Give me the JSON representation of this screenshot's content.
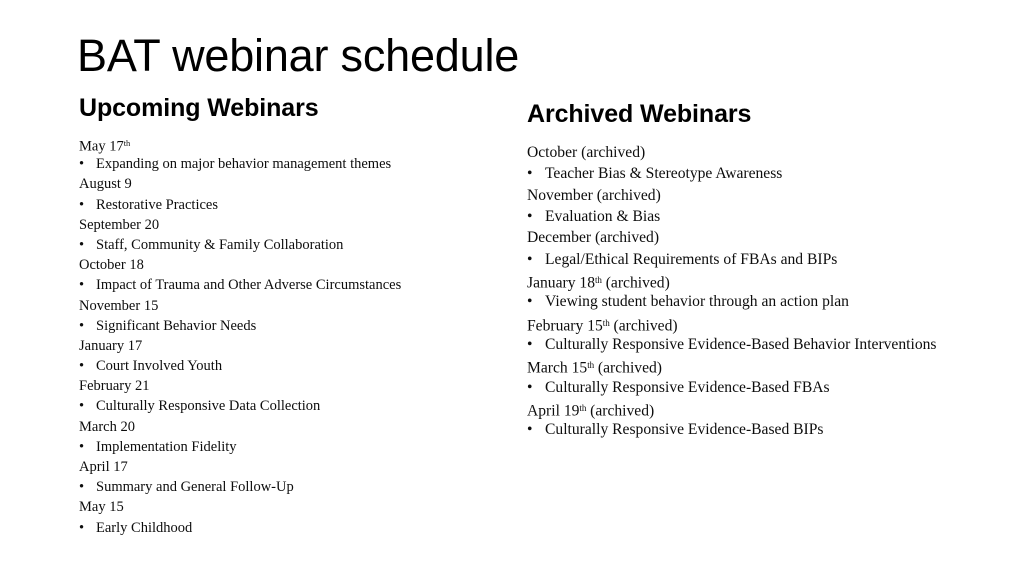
{
  "slide": {
    "title": "BAT webinar schedule",
    "background_color": "#ffffff",
    "text_color": "#000000"
  },
  "columns": {
    "upcoming": {
      "heading": "Upcoming Webinars",
      "bullet_glyph": "•",
      "entries": [
        {
          "date": "May 17",
          "ordinal": "th",
          "topic": "Expanding on major behavior management themes"
        },
        {
          "date": "August 9",
          "ordinal": "",
          "topic": "Restorative Practices"
        },
        {
          "date": "September 20",
          "ordinal": "",
          "topic": "Staff, Community & Family Collaboration"
        },
        {
          "date": "October 18",
          "ordinal": "",
          "topic": "Impact of Trauma and Other Adverse Circumstances"
        },
        {
          "date": "November 15",
          "ordinal": "",
          "topic": "Significant Behavior Needs"
        },
        {
          "date": "January 17",
          "ordinal": "",
          "topic": "Court Involved Youth"
        },
        {
          "date": "February 21",
          "ordinal": "",
          "topic": "Culturally Responsive Data Collection"
        },
        {
          "date": "March 20",
          "ordinal": "",
          "topic": "Implementation Fidelity"
        },
        {
          "date": "April 17",
          "ordinal": "",
          "topic": "Summary and General Follow-Up"
        },
        {
          "date": "May 15",
          "ordinal": "",
          "topic": "Early Childhood"
        }
      ]
    },
    "archived": {
      "heading": "Archived Webinars",
      "bullet_glyph": "•",
      "entries": [
        {
          "date": "October (archived)",
          "ordinal": "",
          "topic": "Teacher Bias & Stereotype Awareness"
        },
        {
          "date": "November (archived)",
          "ordinal": "",
          "topic": "Evaluation & Bias"
        },
        {
          "date": "December (archived)",
          "ordinal": "",
          "topic": "Legal/Ethical Requirements of FBAs and BIPs"
        },
        {
          "date_prefix": "January 18",
          "ordinal": "th",
          "date_suffix": " (archived)",
          "topic": "Viewing student behavior through an action plan"
        },
        {
          "date_prefix": "February 15",
          "ordinal": "th",
          "date_suffix": " (archived)",
          "topic": "Culturally Responsive Evidence-Based Behavior Interventions"
        },
        {
          "date_prefix": "March 15",
          "ordinal": "th",
          "date_suffix": " (archived)",
          "topic": "Culturally Responsive Evidence-Based FBAs"
        },
        {
          "date_prefix": "April 19",
          "ordinal": "th",
          "date_suffix": " (archived)",
          "topic": "Culturally Responsive Evidence-Based BIPs"
        }
      ]
    }
  }
}
